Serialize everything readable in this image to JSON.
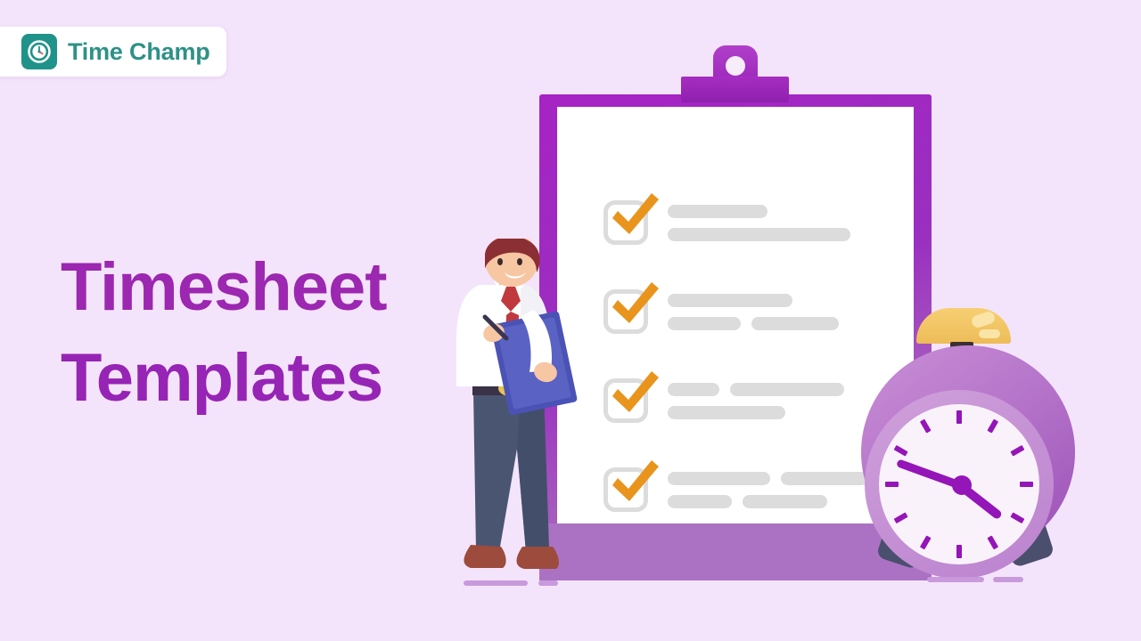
{
  "page": {
    "background_color": "#f4e4fb",
    "kind": "marketing-banner"
  },
  "logo": {
    "brand_name": "Time Champ",
    "mark_icon": "clock-icon",
    "mark_color": "#1f9389",
    "text_color": "#2e9187",
    "badge_background": "#ffffff"
  },
  "headline": {
    "line1": "Timesheet",
    "line2": "Templates",
    "color": "#9c27b0"
  },
  "illustration": {
    "clipboard": {
      "frame_color": "#a623c4",
      "paper_color": "#ffffff",
      "clip_icon": "clipboard-clip-icon",
      "checklist": [
        {
          "checked": true,
          "check_color": "#e8941d",
          "lines": [
            [
              112
            ],
            [
              205
            ]
          ]
        },
        {
          "checked": true,
          "check_color": "#e8941d",
          "lines": [
            [
              140
            ],
            [
              82,
              98
            ]
          ]
        },
        {
          "checked": true,
          "check_color": "#e8941d",
          "lines": [
            [
              58,
              128
            ],
            [
              132
            ]
          ]
        },
        {
          "checked": true,
          "check_color": "#e8941d",
          "lines": [
            [
              115,
              98
            ],
            [
              72,
              95
            ]
          ]
        }
      ]
    },
    "clock": {
      "label": "alarm-clock",
      "bell_color": "#edbc58",
      "case_color": "#b473c9",
      "face_color": "#faf2fb",
      "hand_color": "#9415b8",
      "foot_color": "#4a4f6e",
      "tick_count": 12,
      "hour_hand_deg": 38,
      "minute_hand_deg": 200
    },
    "person": {
      "label": "businessman-with-clipboard",
      "hair_color": "#8c2f34",
      "shirt_color": "#ffffff",
      "tie_color": "#c0393f",
      "pants_color": "#4a5572",
      "shoe_color": "#9d4b3c",
      "board_color": "#4a53b5"
    }
  }
}
